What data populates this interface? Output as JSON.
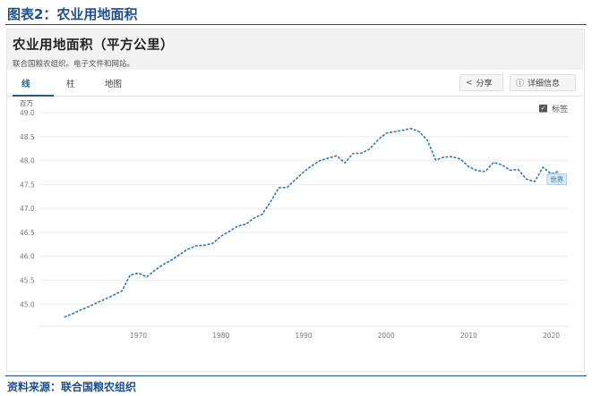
{
  "figure": {
    "title": "图表2：农业用地面积",
    "source": "资料来源：联合国粮农组织"
  },
  "widget": {
    "title": "农业用地面积（平方公里）",
    "subtitle": "联合国粮农组织。电子文件和网站。",
    "tabs": [
      {
        "label": "线",
        "active": true
      },
      {
        "label": "柱",
        "active": false
      },
      {
        "label": "地图",
        "active": false
      }
    ],
    "buttons": {
      "share": "分享",
      "details": "详细信息"
    },
    "labels_toggle": "标签",
    "accent_color": "#1f5b93",
    "line_color": "#2f79b5"
  },
  "chart_data": {
    "type": "line",
    "title": "农业用地面积（平方公里）",
    "y_unit_label": "百万",
    "x_range": [
      1958,
      2022
    ],
    "y_range": [
      44.8,
      49.0
    ],
    "x_ticks": [
      "1970",
      "1980",
      "1990",
      "2000",
      "2010",
      "2020"
    ],
    "y_ticks": [
      "45.0",
      "45.5",
      "46.0",
      "46.5",
      "47.0",
      "47.5",
      "48.0",
      "48.5",
      "49.0"
    ],
    "gridlines": true,
    "series": [
      {
        "name": "世界",
        "x": [
          1961,
          1962,
          1963,
          1964,
          1965,
          1966,
          1967,
          1968,
          1969,
          1970,
          1971,
          1972,
          1973,
          1974,
          1975,
          1976,
          1977,
          1978,
          1979,
          1980,
          1981,
          1982,
          1983,
          1984,
          1985,
          1986,
          1987,
          1988,
          1989,
          1990,
          1991,
          1992,
          1993,
          1994,
          1995,
          1996,
          1997,
          1998,
          1999,
          2000,
          2001,
          2002,
          2003,
          2004,
          2005,
          2006,
          2007,
          2008,
          2009,
          2010,
          2011,
          2012,
          2013,
          2014,
          2015,
          2016,
          2017,
          2018,
          2019,
          2020,
          2021
        ],
        "values": [
          44.73,
          44.8,
          44.88,
          44.95,
          45.03,
          45.11,
          45.19,
          45.28,
          45.61,
          45.65,
          45.57,
          45.71,
          45.83,
          45.92,
          46.04,
          46.15,
          46.22,
          46.23,
          46.27,
          46.42,
          46.52,
          46.63,
          46.67,
          46.8,
          46.88,
          47.14,
          47.43,
          47.44,
          47.6,
          47.76,
          47.89,
          48.0,
          48.05,
          48.1,
          47.95,
          48.15,
          48.15,
          48.24,
          48.43,
          48.57,
          48.6,
          48.63,
          48.67,
          48.6,
          48.42,
          48.01,
          48.07,
          48.08,
          48.03,
          47.87,
          47.79,
          47.77,
          47.96,
          47.91,
          47.8,
          47.81,
          47.61,
          47.56,
          47.86,
          47.72,
          47.78
        ]
      }
    ]
  }
}
